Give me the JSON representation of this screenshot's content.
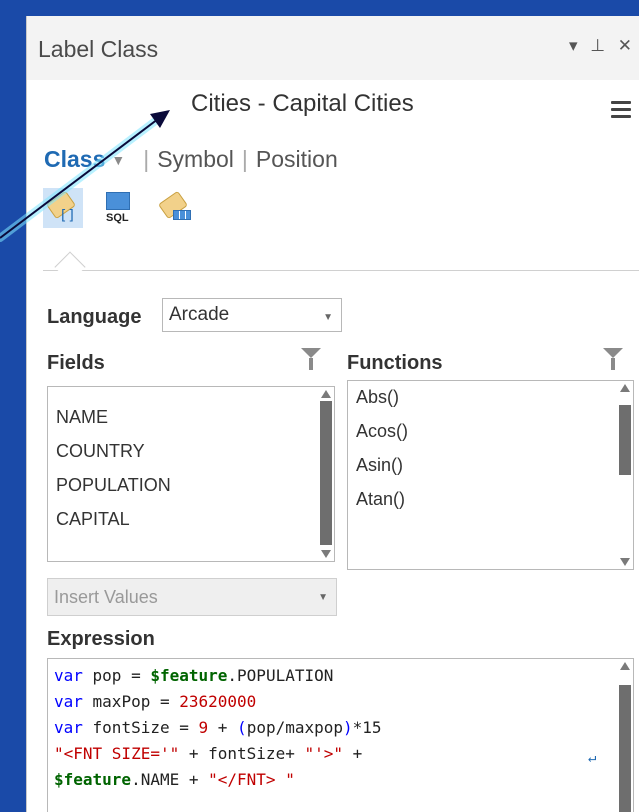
{
  "panel": {
    "title": "Label Class",
    "controls": "▾ ⊥ ✕",
    "class_name": "Cities - Capital Cities"
  },
  "tabs": {
    "class": "Class",
    "symbol": "Symbol",
    "position": "Position"
  },
  "toolbar_icons": {
    "sql_label": "SQL"
  },
  "language": {
    "label": "Language",
    "value": "Arcade"
  },
  "fields": {
    "label": "Fields",
    "items": [
      "NAME",
      "COUNTRY",
      "POPULATION",
      "CAPITAL"
    ]
  },
  "functions": {
    "label": "Functions",
    "items": [
      "Abs()",
      "Acos()",
      "Asin()",
      "Atan()"
    ]
  },
  "insert_values": {
    "label": "Insert Values"
  },
  "expression": {
    "label": "Expression",
    "lines": [
      [
        "var",
        " pop = ",
        "$feature",
        ".POPULATION"
      ],
      [
        "var",
        " maxPop = ",
        "23620000"
      ],
      [
        "var",
        " fontSize = ",
        "9",
        " + ",
        "(",
        "pop/maxpop",
        ")",
        "*15"
      ],
      [
        "\"<FNT SIZE='\"",
        " + fontSize+ ",
        "\"'>\"",
        " +"
      ],
      [
        "$feature",
        ".NAME + ",
        "\"</FNT> \""
      ]
    ]
  },
  "colors": {
    "background": "#1a4aa8",
    "accent": "#1f6ab3",
    "arrow": "#0a0a3a"
  }
}
